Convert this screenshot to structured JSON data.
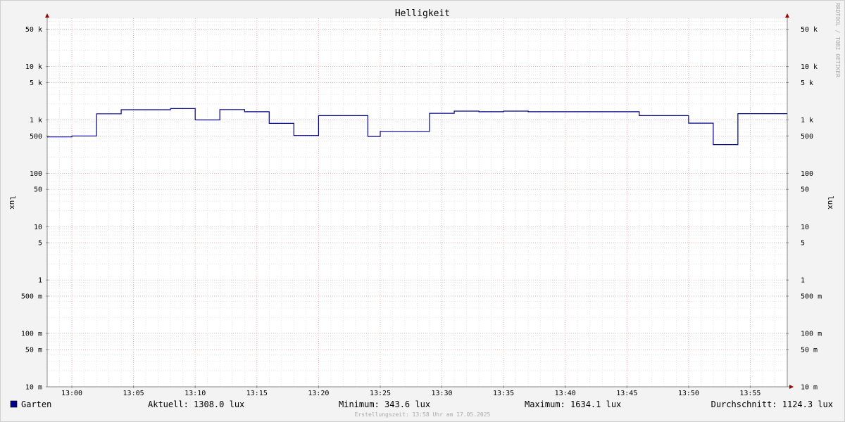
{
  "chart_data": {
    "type": "line",
    "title": "Helligkeit",
    "ylabel_left": "lux",
    "ylabel_right": "lux",
    "y_scale": "log",
    "ylim": [
      0.01,
      80000
    ],
    "xlim": [
      "12:58",
      "13:58"
    ],
    "x_ticks": [
      "13:00",
      "13:05",
      "13:10",
      "13:15",
      "13:20",
      "13:25",
      "13:30",
      "13:35",
      "13:40",
      "13:45",
      "13:50",
      "13:55"
    ],
    "y_ticks": [
      {
        "value": 50000,
        "label": "50 k"
      },
      {
        "value": 10000,
        "label": "10 k"
      },
      {
        "value": 5000,
        "label": "5 k"
      },
      {
        "value": 1000,
        "label": "1 k"
      },
      {
        "value": 500,
        "label": "500"
      },
      {
        "value": 100,
        "label": "100"
      },
      {
        "value": 50,
        "label": "50"
      },
      {
        "value": 10,
        "label": "10"
      },
      {
        "value": 5,
        "label": "5"
      },
      {
        "value": 1,
        "label": "1"
      },
      {
        "value": 0.5,
        "label": "500 m"
      },
      {
        "value": 0.1,
        "label": "100 m"
      },
      {
        "value": 0.05,
        "label": "50 m"
      },
      {
        "value": 0.01,
        "label": "10 m"
      }
    ],
    "series": [
      {
        "name": "Garten",
        "color": "#00008b",
        "steps": [
          {
            "x": "12:58",
            "y": 480
          },
          {
            "x": "13:00",
            "y": 500
          },
          {
            "x": "13:02",
            "y": 1300
          },
          {
            "x": "13:04",
            "y": 1550
          },
          {
            "x": "13:08",
            "y": 1630
          },
          {
            "x": "13:10",
            "y": 1000
          },
          {
            "x": "13:12",
            "y": 1560
          },
          {
            "x": "13:14",
            "y": 1420
          },
          {
            "x": "13:16",
            "y": 860
          },
          {
            "x": "13:18",
            "y": 510
          },
          {
            "x": "13:20",
            "y": 1200
          },
          {
            "x": "13:24",
            "y": 490
          },
          {
            "x": "13:25",
            "y": 610
          },
          {
            "x": "13:29",
            "y": 1330
          },
          {
            "x": "13:31",
            "y": 1460
          },
          {
            "x": "13:33",
            "y": 1420
          },
          {
            "x": "13:35",
            "y": 1460
          },
          {
            "x": "13:37",
            "y": 1420
          },
          {
            "x": "13:46",
            "y": 1200
          },
          {
            "x": "13:50",
            "y": 870
          },
          {
            "x": "13:52",
            "y": 344
          },
          {
            "x": "13:54",
            "y": 1308
          },
          {
            "x": "13:58",
            "y": 1308
          }
        ]
      }
    ],
    "legend": {
      "series_name": "Garten",
      "color": "#00008b",
      "current": "Aktuell: 1308.0 lux",
      "minimum": "Minimum: 343.6 lux",
      "maximum": "Maximum: 1634.1 lux",
      "average": "Durchschnitt: 1124.3 lux"
    },
    "watermark": "RRDTOOL / TOBI OETIKER",
    "footer": "Erstellungszeit: 13:58 Uhr am 17.05.2025",
    "grid": true
  }
}
